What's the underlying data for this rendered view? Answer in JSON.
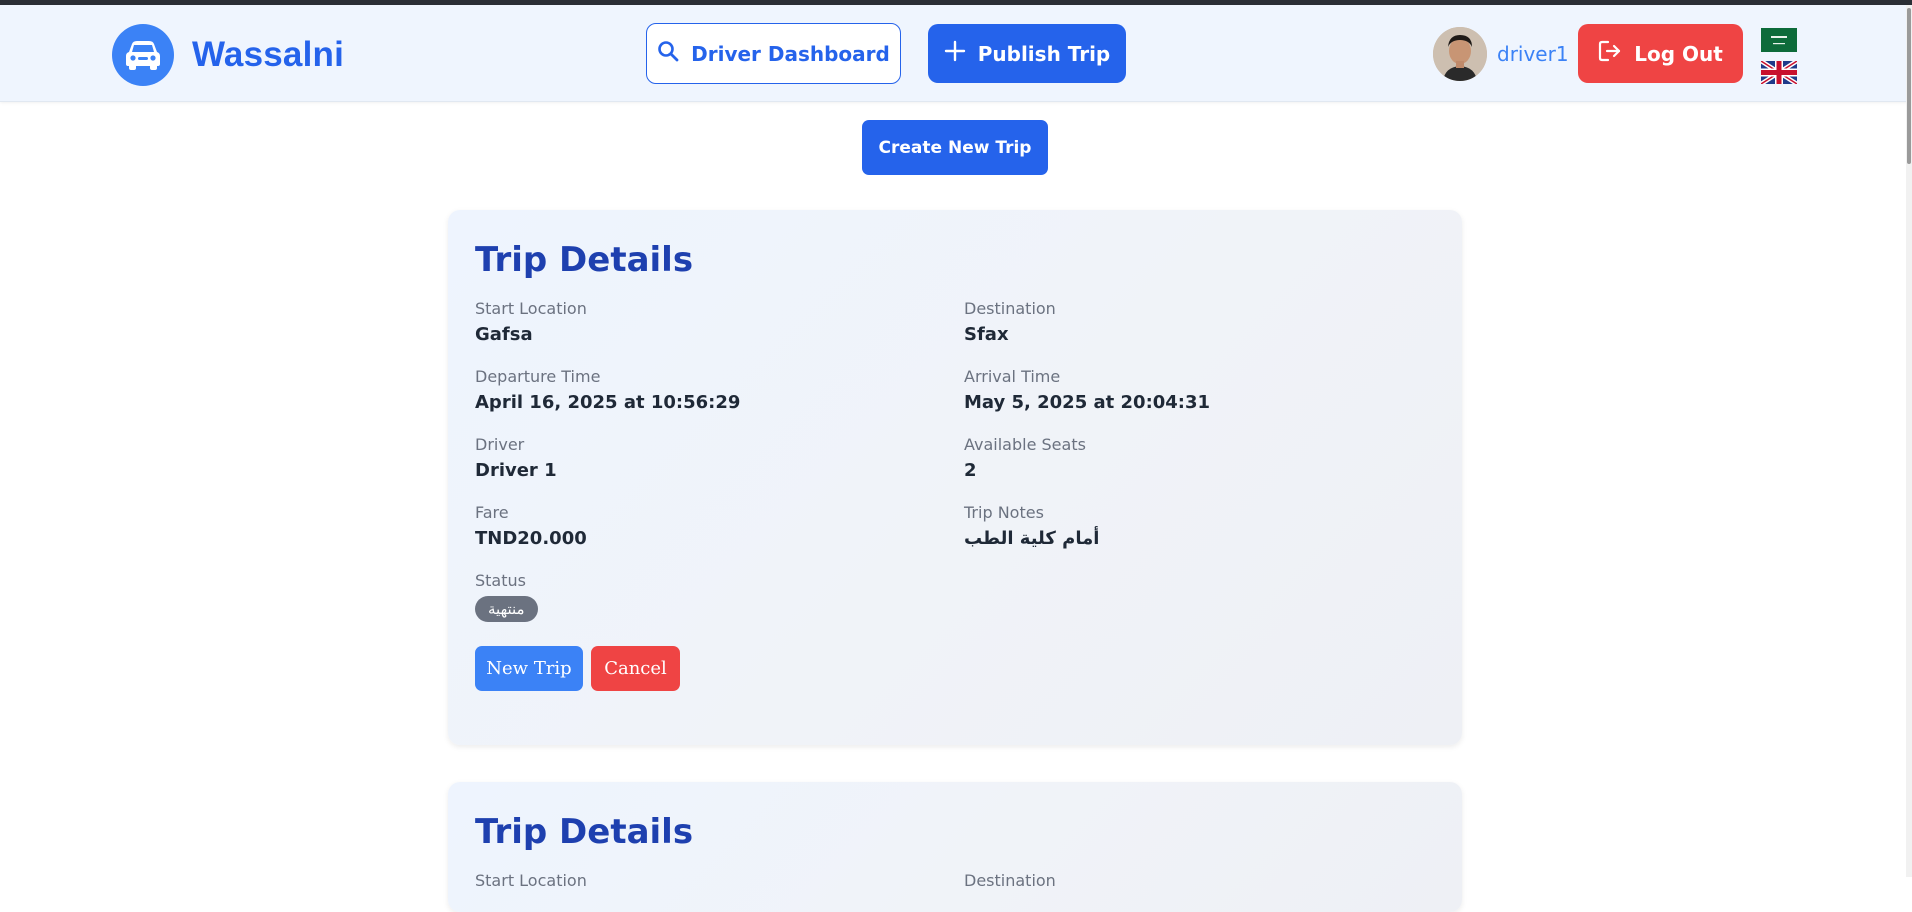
{
  "navbar": {
    "brand": "Wassalni",
    "driver_dashboard_label": "Driver Dashboard",
    "publish_trip_label": "Publish Trip",
    "username": "driver1",
    "logout_label": "Log Out",
    "icons": [
      "car-icon",
      "search-icon",
      "plus-icon",
      "logout-icon",
      "saudi-flag-icon",
      "uk-flag-icon"
    ]
  },
  "create_new_trip_label": "Create New Trip",
  "trips": [
    {
      "title": "Trip Details",
      "start_location_label": "Start Location",
      "start_location": "Gafsa",
      "destination_label": "Destination",
      "destination": "Sfax",
      "departure_time_label": "Departure Time",
      "departure_time": "April 16, 2025 at 10:56:29",
      "arrival_time_label": "Arrival Time",
      "arrival_time": "May 5, 2025 at 20:04:31",
      "driver_label": "Driver",
      "driver": "Driver 1",
      "available_seats_label": "Available Seats",
      "available_seats": "2",
      "fare_label": "Fare",
      "fare": "TND20.000",
      "trip_notes_label": "Trip Notes",
      "trip_notes": "أمام كلية الطب",
      "status_label": "Status",
      "status": "منتهية",
      "new_trip_label": "New Trip",
      "cancel_label": "Cancel"
    },
    {
      "title": "Trip Details",
      "start_location_label": "Start Location",
      "destination_label": "Destination"
    }
  ],
  "colors": {
    "primary": "#2563eb",
    "accent": "#3b82f6",
    "danger": "#ef4444",
    "title": "#1e40af",
    "status_badge": "#6b7280"
  }
}
